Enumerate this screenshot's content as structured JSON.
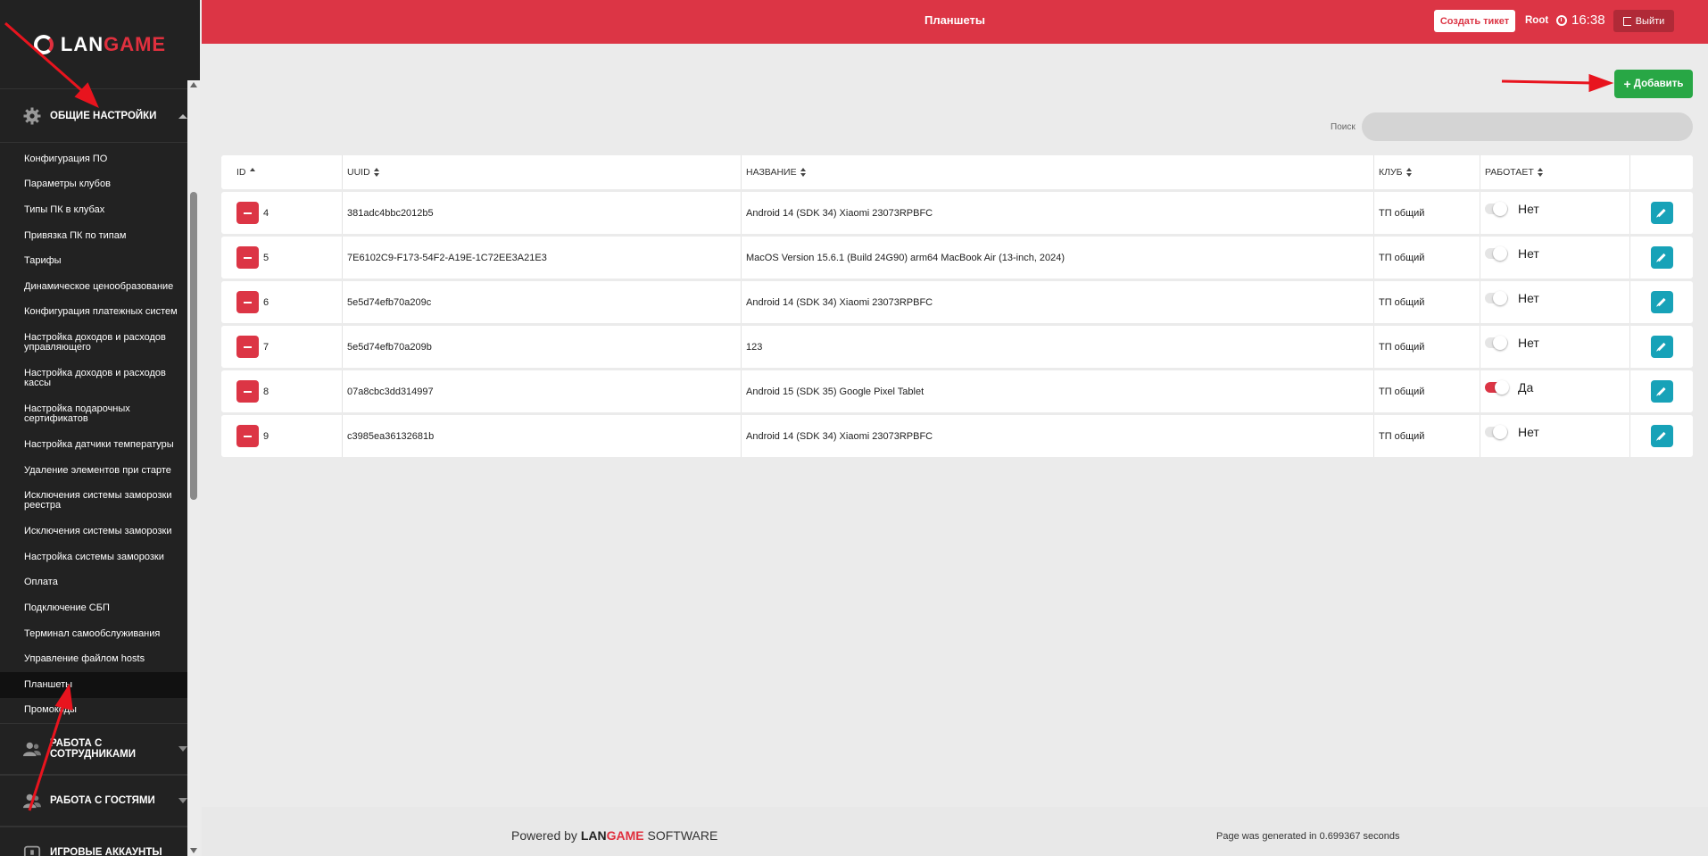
{
  "brand": {
    "logo_left": "LAN",
    "logo_right": "GAME"
  },
  "header": {
    "title": "Планшеты",
    "create_ticket": "Создать тикет",
    "user": "Root",
    "time": "16:38",
    "logout": "Выйти",
    "accent_color": "#dc3545"
  },
  "sidebar": {
    "section_general": "ОБЩИЕ НАСТРОЙКИ",
    "items": [
      "Конфигурация ПО",
      "Параметры клубов",
      "Типы ПК в клубах",
      "Привязка ПК по типам",
      "Тарифы",
      "Динамическое ценообразование",
      "Конфигурация платежных систем",
      "Настройка доходов и расходов управляющего",
      "Настройка доходов и расходов кассы",
      "Настройка подарочных сертификатов",
      "Настройка датчики температуры",
      "Удаление элементов при старте",
      "Исключения системы заморозки реестра",
      "Исключения системы заморозки",
      "Настройка системы заморозки",
      "Оплата",
      "Подключение СБП",
      "Терминал самообслуживания",
      "Управление файлом hosts",
      "Планшеты",
      "Промокоды"
    ],
    "active_item": "Планшеты",
    "section_staff": "РАБОТА С СОТРУДНИКАМИ",
    "section_guests": "РАБОТА С ГОСТЯМИ",
    "section_accounts": "ИГРОВЫЕ АККАУНТЫ"
  },
  "toolbar": {
    "add_label": "Добавить",
    "search_label": "Поиск",
    "search_value": ""
  },
  "table": {
    "columns": [
      "ID",
      "UUID",
      "НАЗВАНИЕ",
      "КЛУБ",
      "РАБОТАЕТ"
    ],
    "rows": [
      {
        "id": "4",
        "uuid": "381adc4bbc2012b5",
        "name": "Android 14 (SDK 34) Xiaomi 23073RPBFC",
        "club": "ТП общий",
        "works": false,
        "works_label": "Нет"
      },
      {
        "id": "5",
        "uuid": "7E6102C9-F173-54F2-A19E-1C72EE3A21E3",
        "name": "MacOS Version 15.6.1 (Build 24G90) arm64 MacBook Air (13-inch, 2024)",
        "club": "ТП общий",
        "works": false,
        "works_label": "Нет"
      },
      {
        "id": "6",
        "uuid": "5e5d74efb70a209c",
        "name": "Android 14 (SDK 34) Xiaomi 23073RPBFC",
        "club": "ТП общий",
        "works": false,
        "works_label": "Нет"
      },
      {
        "id": "7",
        "uuid": "5e5d74efb70a209b",
        "name": "123",
        "club": "ТП общий",
        "works": false,
        "works_label": "Нет"
      },
      {
        "id": "8",
        "uuid": "07a8cbc3dd314997",
        "name": "Android 15 (SDK 35) Google Pixel Tablet",
        "club": "ТП общий",
        "works": true,
        "works_label": "Да"
      },
      {
        "id": "9",
        "uuid": "c3985ea36132681b",
        "name": "Android 14 (SDK 34) Xiaomi 23073RPBFC",
        "club": "ТП общий",
        "works": false,
        "works_label": "Нет"
      }
    ]
  },
  "footer": {
    "powered_prefix": "Powered by",
    "powered_lan": "LAN",
    "powered_game": "GAME",
    "powered_suffix": "SOFTWARE",
    "generated": "Page was generated in 0.699367 seconds"
  },
  "icons": {
    "settings": "gear-icon",
    "staff": "people-icon",
    "guests": "people-icon",
    "accounts": "gamepad-icon",
    "delete": "minus-icon",
    "edit": "pencil-icon",
    "add": "plus-icon",
    "clock": "clock-icon",
    "logout": "sign-out-icon"
  },
  "colors": {
    "danger": "#dc3545",
    "success": "#28a745",
    "info": "#17a2b8",
    "sidebar": "#222222"
  }
}
